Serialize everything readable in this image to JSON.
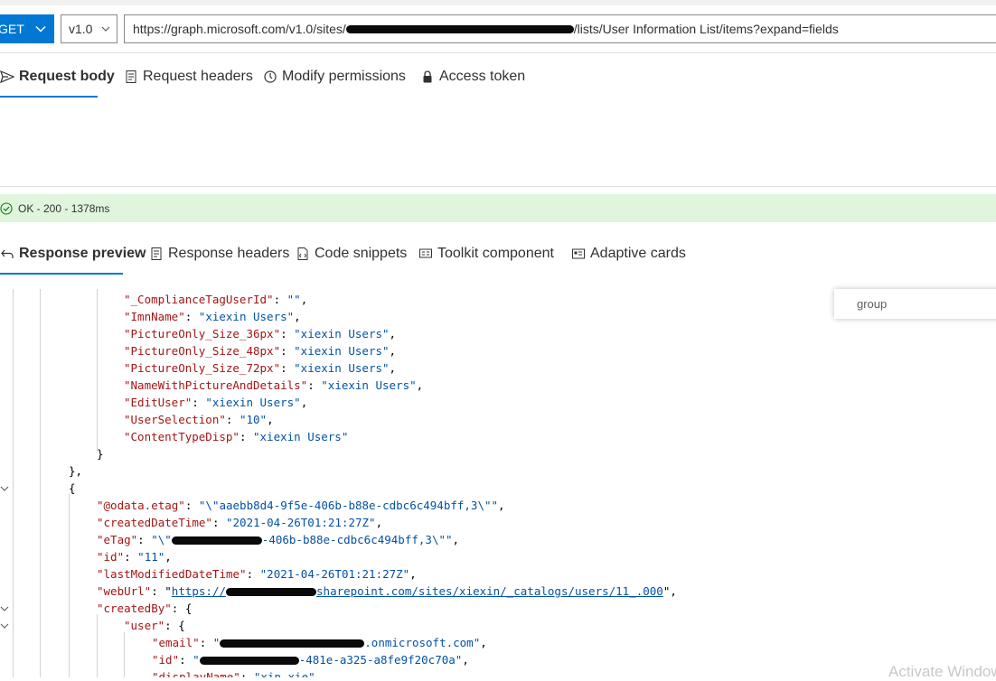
{
  "request": {
    "method": "GET",
    "version": "v1.0",
    "url_prefix": "https://graph.microsoft.com/v1.0/sites/",
    "url_suffix": "/lists/User Information List/items?expand=fields"
  },
  "request_tabs": [
    {
      "label": "Request body",
      "icon": "send-icon",
      "active": true
    },
    {
      "label": "Request headers",
      "icon": "document-icon",
      "active": false
    },
    {
      "label": "Modify permissions",
      "icon": "shield-icon",
      "active": false
    },
    {
      "label": "Access token",
      "icon": "lock-icon",
      "active": false
    }
  ],
  "status": {
    "text": "OK - 200 - 1378ms",
    "icon": "checkmark-circle-icon",
    "color": "#dff6dd"
  },
  "response_tabs": [
    {
      "label": "Response preview",
      "icon": "undo-arrow-icon",
      "active": true
    },
    {
      "label": "Response headers",
      "icon": "document-icon",
      "active": false
    },
    {
      "label": "Code snippets",
      "icon": "code-file-icon",
      "active": false
    },
    {
      "label": "Toolkit component",
      "icon": "toolkit-icon",
      "active": false
    },
    {
      "label": "Adaptive cards",
      "icon": "card-icon",
      "active": false
    }
  ],
  "find_box": {
    "value": "group"
  },
  "watermark": "Activate Windows",
  "code": {
    "l0": {
      "k": "\"_ComplianceTagUserId\"",
      "v": "\"\""
    },
    "l1": {
      "k": "\"ImnName\"",
      "v": "\"xiexin Users\""
    },
    "l2": {
      "k": "\"PictureOnly_Size_36px\"",
      "v": "\"xiexin Users\""
    },
    "l3": {
      "k": "\"PictureOnly_Size_48px\"",
      "v": "\"xiexin Users\""
    },
    "l4": {
      "k": "\"PictureOnly_Size_72px\"",
      "v": "\"xiexin Users\""
    },
    "l5": {
      "k": "\"NameWithPictureAndDetails\"",
      "v": "\"xiexin Users\""
    },
    "l6": {
      "k": "\"EditUser\"",
      "v": "\"xiexin Users\""
    },
    "l7": {
      "k": "\"UserSelection\"",
      "v": "\"10\""
    },
    "l8": {
      "k": "\"ContentTypeDisp\"",
      "v": "\"xiexin Users\""
    },
    "l12": {
      "k": "\"@odata.etag\"",
      "v": "\"\\\"aaebb8d4-9f5e-406b-b88e-cdbc6c494bff,3\\\"\""
    },
    "l13": {
      "k": "\"createdDateTime\"",
      "v": "\"2021-04-26T01:21:27Z\""
    },
    "l14": {
      "k": "\"eTag\"",
      "v1": "\"\\\"",
      "v2": "-406b-b88e-cdbc6c494bff,3\\\"\""
    },
    "l15": {
      "k": "\"id\"",
      "v": "\"11\""
    },
    "l16": {
      "k": "\"lastModifiedDateTime\"",
      "v": "\"2021-04-26T01:21:27Z\""
    },
    "l17": {
      "k": "\"webUrl\"",
      "v1": "https://",
      "v2": "sharepoint.com/sites/xiexin/_catalogs/users/11_.000"
    },
    "l18": {
      "k": "\"createdBy\""
    },
    "l19": {
      "k": "\"user\""
    },
    "l20": {
      "k": "\"email\"",
      "v1": "\"",
      "v2": ".onmicrosoft.com\""
    },
    "l21": {
      "k": "\"id\"",
      "v1": "\"",
      "v2": "-481e-a325-a8fe9f20c70a\""
    },
    "l22": {
      "k": "\"displayName\"",
      "v": "\"xin xie\""
    }
  }
}
